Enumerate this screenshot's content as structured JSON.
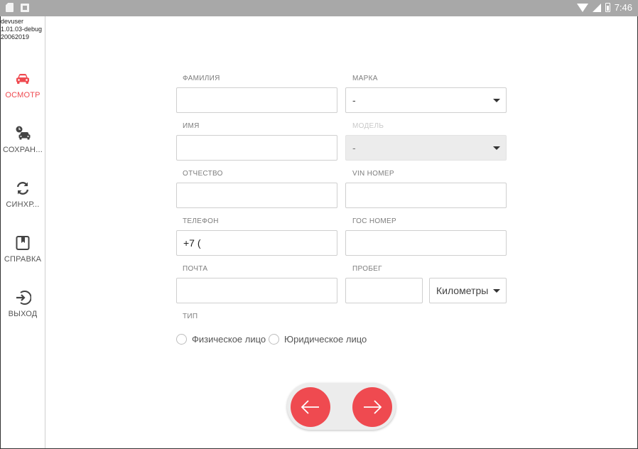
{
  "status_bar": {
    "time": "7:46"
  },
  "app_info": {
    "version_text": "devuser\n1.01.03-debug\n20062019"
  },
  "sidebar": {
    "items": [
      {
        "label": "ОСМОТР",
        "icon": "car-icon",
        "active": true
      },
      {
        "label": "СОХРАН...",
        "icon": "saved-car-icon",
        "active": false
      },
      {
        "label": "СИНХР...",
        "icon": "sync-icon",
        "active": false
      },
      {
        "label": "СПРАВКА",
        "icon": "bookmark-icon",
        "active": false
      },
      {
        "label": "ВЫХОД",
        "icon": "logout-icon",
        "active": false
      }
    ]
  },
  "form": {
    "surname": {
      "label": "ФАМИЛИЯ",
      "value": ""
    },
    "name": {
      "label": "ИМЯ",
      "value": ""
    },
    "patronymic": {
      "label": "ОТЧЕСТВО",
      "value": ""
    },
    "phone": {
      "label": "ТЕЛЕФОН",
      "value": "+7 ("
    },
    "email": {
      "label": "ПОЧТА",
      "value": ""
    },
    "brand": {
      "label": "МАРКА",
      "value": "-"
    },
    "model": {
      "label": "МОДЕЛЬ",
      "value": "-",
      "disabled": true
    },
    "vin": {
      "label": "VIN НОМЕР",
      "value": ""
    },
    "plate": {
      "label": "ГОС НОМЕР",
      "value": ""
    },
    "mileage": {
      "label": "ПРОБЕГ",
      "value": "",
      "unit": "Километры"
    },
    "type": {
      "label": "ТИП",
      "options": [
        "Физическое лицо",
        "Юридическое лицо"
      ]
    }
  },
  "colors": {
    "accent": "#ef4a50",
    "status_bar": "#a8a8a8",
    "border": "#cfcfcf"
  }
}
